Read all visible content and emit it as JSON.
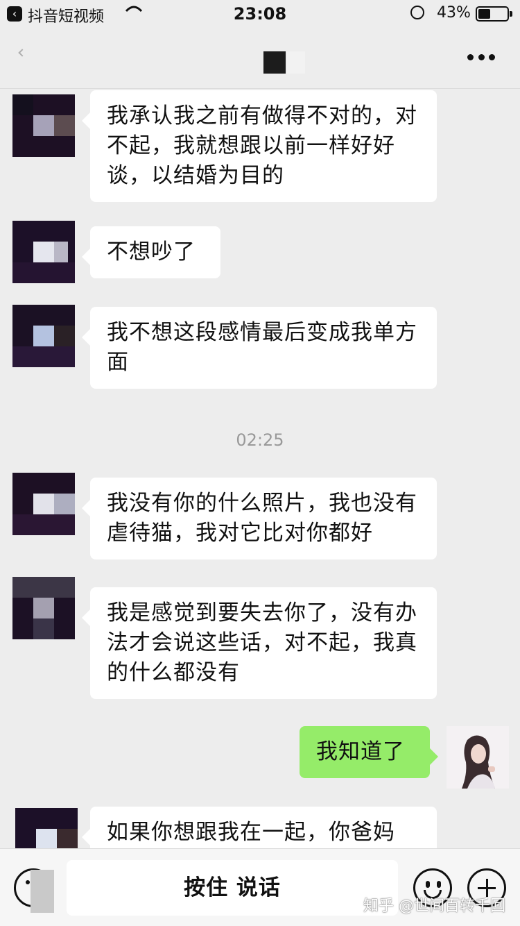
{
  "status_bar": {
    "back_glyph": "‹",
    "app_name": "抖音短视频",
    "time": "23:08",
    "battery_text": "43%",
    "battery_level": 0.43
  },
  "nav": {
    "more_icon": "more-dots-icon"
  },
  "messages": [
    {
      "sender": "other",
      "text": "我承认我之前有做得不对的，对不起，我就想跟以前一样好好谈，以结婚为目的"
    },
    {
      "sender": "other",
      "text": "不想吵了"
    },
    {
      "sender": "other",
      "text": "我不想这段感情最后变成我单方面"
    },
    {
      "type": "timestamp",
      "text": "02:25"
    },
    {
      "sender": "other",
      "text": "我没有你的什么照片，我也没有虐待猫，我对它比对你都好"
    },
    {
      "sender": "other",
      "text": "我是感觉到要失去你了，没有办法才会说这些话，对不起，我真的什么都没有"
    },
    {
      "sender": "me",
      "text": "我知道了"
    },
    {
      "sender": "other",
      "text": "如果你想跟我在一起，你爸妈"
    }
  ],
  "input_bar": {
    "hold_to_talk_label": "按住 说话",
    "watermark": "知乎 @世间百转千回"
  },
  "colors": {
    "background": "#ededed",
    "my_bubble": "#95ec69",
    "other_bubble": "#ffffff"
  }
}
